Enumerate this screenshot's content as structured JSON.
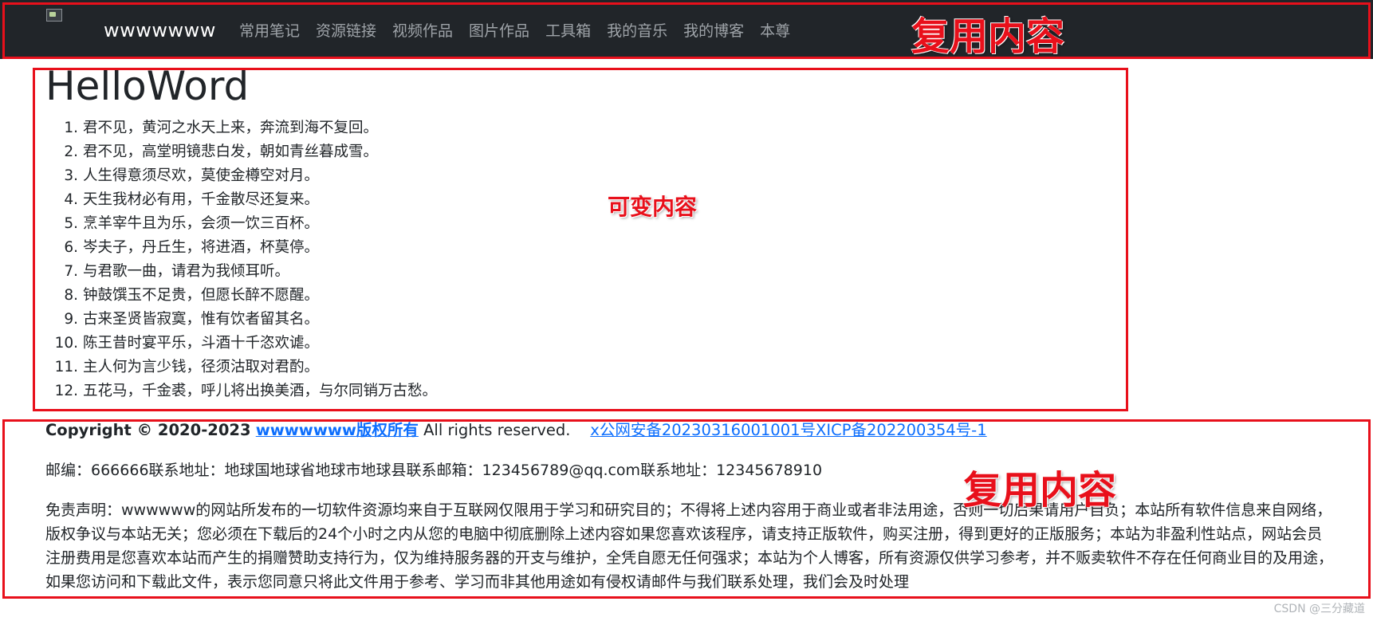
{
  "navbar": {
    "brand": "wwwwwww",
    "links": [
      "常用笔记",
      "资源链接",
      "视频作品",
      "图片作品",
      "工具箱",
      "我的音乐",
      "我的博客",
      "本尊"
    ]
  },
  "annotations": {
    "top": "复用内容",
    "middle": "可变内容",
    "bottom": "复用内容",
    "color": "#e8101b"
  },
  "main": {
    "title": "HelloWord",
    "poem": [
      "君不见，黄河之水天上来，奔流到海不复回。",
      "君不见，高堂明镜悲白发，朝如青丝暮成雪。",
      "人生得意须尽欢，莫使金樽空对月。",
      "天生我材必有用，千金散尽还复来。",
      "烹羊宰牛且为乐，会须一饮三百杯。",
      "岑夫子，丹丘生，将进酒，杯莫停。",
      "与君歌一曲，请君为我倾耳听。",
      "钟鼓馔玉不足贵，但愿长醉不愿醒。",
      "古来圣贤皆寂寞，惟有饮者留其名。",
      "陈王昔时宴平乐，斗酒十千恣欢谑。",
      "主人何为言少钱，径须沽取对君酌。",
      "五花马，千金裘，呼儿将出换美酒，与尔同销万古愁。"
    ]
  },
  "footer": {
    "copyright_prefix": "Copyright © 2020-2023",
    "copyright_link": "wwwwwww版权所有",
    "rights": "All rights reserved.",
    "icp_link": "x公网安备20230316001001号XICP备202200354号-1",
    "contact": "邮编：666666联系地址：地球国地球省地球市地球县联系邮箱：123456789@qq.com联系地址：12345678910",
    "disclaimer": "免责声明：wwwwww的网站所发布的一切软件资源均来自于互联网仅限用于学习和研究目的；不得将上述内容用于商业或者非法用途，否则一切后果请用户自负；本站所有软件信息来自网络，版权争议与本站无关；您必须在下载后的24个小时之内从您的电脑中彻底删除上述内容如果您喜欢该程序，请支持正版软件，购买注册，得到更好的正版服务；本站为非盈利性站点，网站会员注册费用是您喜欢本站而产生的捐赠赞助支持行为，仅为维持服务器的开支与维护，全凭自愿无任何强求；本站为个人博客，所有资源仅供学习参考，并不贩卖软件不存在任何商业目的及用途，如果您访问和下载此文件，表示您同意只将此文件用于参考、学习而非其他用途如有侵权请邮件与我们联系处理，我们会及时处理"
  },
  "watermark": "CSDN @三分藏道"
}
